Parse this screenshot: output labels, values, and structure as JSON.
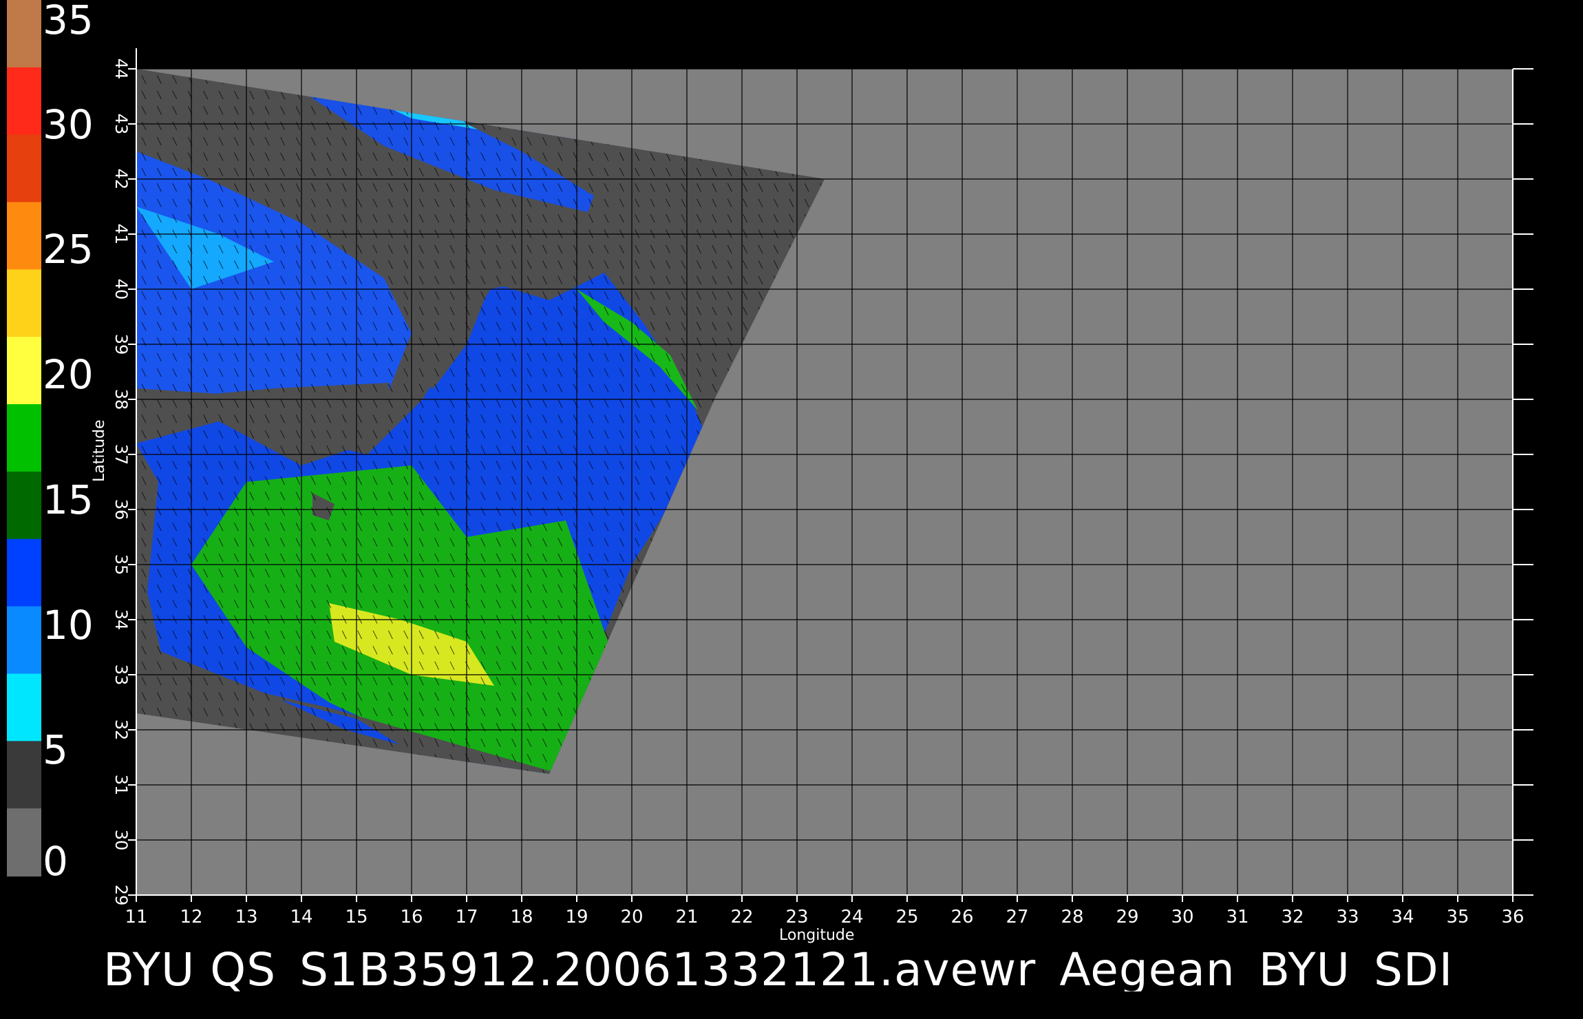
{
  "colorbar": {
    "labels": [
      "35",
      "30",
      "25",
      "20",
      "15",
      "10",
      "5",
      "0"
    ],
    "values": [
      35,
      30,
      25,
      20,
      15,
      10,
      5,
      0
    ],
    "colors": [
      "#c07a4a",
      "#ff2a1a",
      "#e6400e",
      "#ff8a10",
      "#ffd21a",
      "#ffff40",
      "#00c000",
      "#006a00",
      "#0040ff",
      "#0a8aff",
      "#00e6ff",
      "#3a3a3a",
      "#6e6e6e"
    ]
  },
  "axes": {
    "xlabel": "Longitude",
    "ylabel": "Latitude",
    "xticks": [
      "11",
      "12",
      "13",
      "14",
      "15",
      "16",
      "17",
      "18",
      "19",
      "20",
      "21",
      "22",
      "23",
      "24",
      "25",
      "26",
      "27",
      "28",
      "29",
      "30",
      "31",
      "32",
      "33",
      "34",
      "35",
      "36"
    ],
    "yticks": [
      "29",
      "30",
      "31",
      "32",
      "33",
      "34",
      "35",
      "36",
      "37",
      "38",
      "39",
      "40",
      "41",
      "42",
      "43",
      "44"
    ],
    "xlim": [
      11,
      36
    ],
    "ylim": [
      29,
      44
    ]
  },
  "map": {
    "background_color": "#808080",
    "swath_color": "#4f4f4f",
    "grid": true,
    "swath_corners": [
      [
        11,
        44
      ],
      [
        23.5,
        42
      ],
      [
        21.5,
        38
      ],
      [
        18.5,
        31.2
      ],
      [
        11,
        32.3
      ]
    ],
    "grid_color": "#000000"
  },
  "caption": "BYU  QS_S1B35912.20061332121.avewr_Aegean_BYU_SDI"
}
